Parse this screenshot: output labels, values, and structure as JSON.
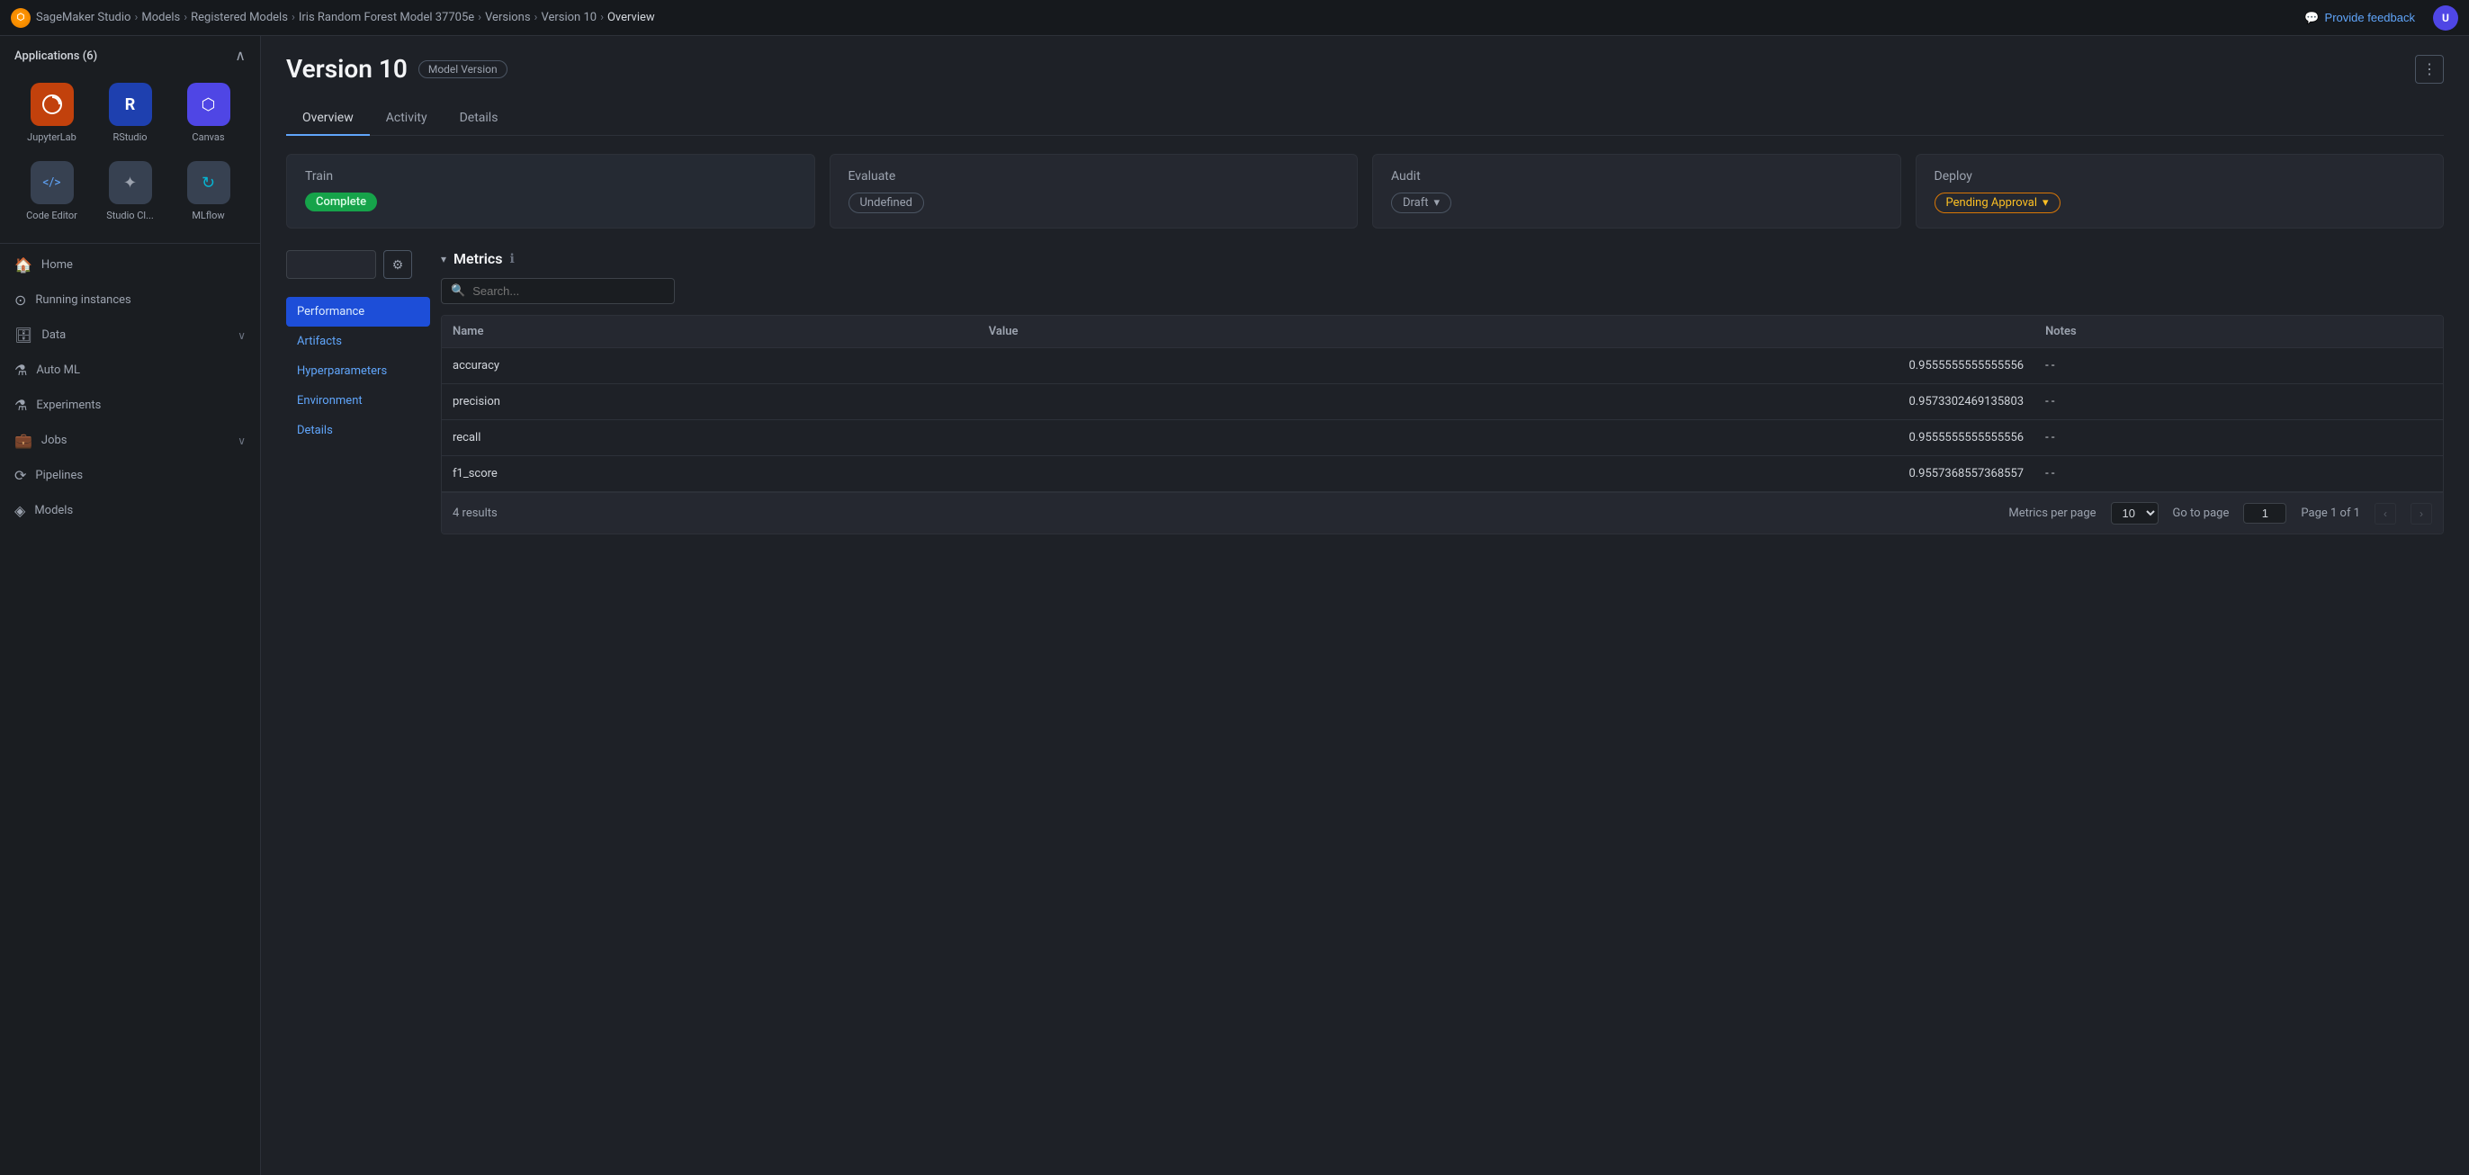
{
  "topnav": {
    "logo": "SM",
    "breadcrumbs": [
      {
        "label": "SageMaker Studio",
        "link": true
      },
      {
        "label": "Models",
        "link": true
      },
      {
        "label": "Registered Models",
        "link": true
      },
      {
        "label": "Iris Random Forest Model 37705e",
        "link": true
      },
      {
        "label": "Versions",
        "link": true
      },
      {
        "label": "Version 10",
        "link": true
      },
      {
        "label": "Overview",
        "link": false
      }
    ],
    "feedback_label": "Provide feedback",
    "user_initial": "U"
  },
  "sidebar": {
    "apps_header": "Applications (6)",
    "apps": [
      {
        "label": "JupyterLab",
        "icon": "🔵",
        "bg": "#c2410c"
      },
      {
        "label": "RStudio",
        "icon": "R",
        "bg": "#1e40af"
      },
      {
        "label": "Canvas",
        "icon": "⬡",
        "bg": "#4f46e5"
      },
      {
        "label": "Code Editor",
        "icon": "</>",
        "bg": "#374151"
      },
      {
        "label": "Studio Cl...",
        "icon": "✦",
        "bg": "#374151"
      },
      {
        "label": "MLflow",
        "icon": "↻",
        "bg": "#374151"
      }
    ],
    "nav_items": [
      {
        "label": "Home",
        "icon": "🏠",
        "has_arrow": false
      },
      {
        "label": "Running instances",
        "icon": "⊙",
        "has_arrow": false
      },
      {
        "label": "Data",
        "icon": "🗄",
        "has_arrow": true
      },
      {
        "label": "Auto ML",
        "icon": "⚗",
        "has_arrow": false
      },
      {
        "label": "Experiments",
        "icon": "⚗",
        "has_arrow": false
      },
      {
        "label": "Jobs",
        "icon": "💼",
        "has_arrow": true
      },
      {
        "label": "Pipelines",
        "icon": "⟳",
        "has_arrow": false
      },
      {
        "label": "Models",
        "icon": "◈",
        "has_arrow": false
      }
    ]
  },
  "page": {
    "title": "Version 10",
    "badge": "Model Version",
    "more_icon": "⋮",
    "tabs": [
      {
        "label": "Overview",
        "active": true
      },
      {
        "label": "Activity",
        "active": false
      },
      {
        "label": "Details",
        "active": false
      }
    ],
    "status_cards": [
      {
        "title": "Train",
        "badge_label": "Complete",
        "badge_type": "complete"
      },
      {
        "title": "Evaluate",
        "badge_label": "Undefined",
        "badge_type": "undefined"
      },
      {
        "title": "Audit",
        "badge_label": "Draft",
        "badge_type": "draft"
      },
      {
        "title": "Deploy",
        "badge_label": "Pending Approval",
        "badge_type": "pending"
      }
    ],
    "metrics": {
      "section_title": "Metrics",
      "search_placeholder": "Search...",
      "sidebar_items": [
        {
          "label": "Performance",
          "active": true
        },
        {
          "label": "Artifacts",
          "active": false
        },
        {
          "label": "Hyperparameters",
          "active": false
        },
        {
          "label": "Environment",
          "active": false
        },
        {
          "label": "Details",
          "active": false
        }
      ],
      "table": {
        "columns": [
          "Name",
          "Value",
          "Notes"
        ],
        "rows": [
          {
            "name": "accuracy",
            "value": "0.9555555555555556",
            "notes": "- -"
          },
          {
            "name": "precision",
            "value": "0.9573302469135803",
            "notes": "- -"
          },
          {
            "name": "recall",
            "value": "0.9555555555555556",
            "notes": "- -"
          },
          {
            "name": "f1_score",
            "value": "0.9557368557368557",
            "notes": "- -"
          }
        ]
      },
      "footer": {
        "results_label": "4 results",
        "per_page_label": "Metrics per page",
        "per_page_value": "10",
        "goto_label": "Go to page",
        "goto_value": "1",
        "page_info": "Page 1 of 1"
      }
    }
  }
}
